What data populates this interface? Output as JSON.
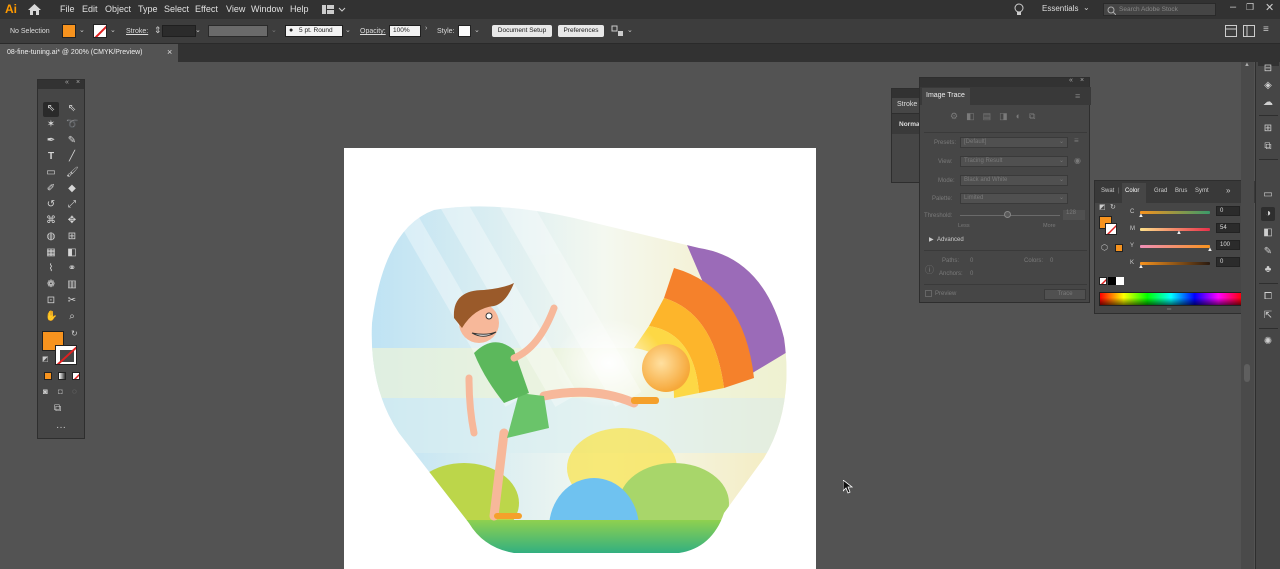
{
  "app": {
    "logo": "Ai"
  },
  "menu": [
    "File",
    "Edit",
    "Object",
    "Type",
    "Select",
    "Effect",
    "View",
    "Window",
    "Help"
  ],
  "workspace": {
    "label": "Essentials",
    "search_placeholder": "Search Adobe Stock"
  },
  "control": {
    "selection": "No Selection",
    "stroke_label": "Stroke:",
    "brush_value": "5 pt. Round",
    "opacity_label": "Opacity:",
    "opacity_value": "100%",
    "style_label": "Style:",
    "document_setup": "Document Setup",
    "preferences": "Preferences"
  },
  "document_tab": {
    "title": "08-fine-tuning.ai* @ 200% (CMYK/Preview)",
    "close": "×"
  },
  "colors": {
    "fill": "#f7931e",
    "accent": "#e8e8e8"
  },
  "stroke_panel": {
    "tab": "Stroke",
    "mode": "Norma"
  },
  "image_trace": {
    "title": "Image Trace",
    "preset_label": "Presets:",
    "preset_value": "[Default]",
    "view_label": "View:",
    "view_value": "Tracing Result",
    "mode_label": "Mode:",
    "mode_value": "Black and White",
    "palette_label": "Palette:",
    "palette_value": "Limited",
    "threshold_label": "Threshold:",
    "threshold_value": "128",
    "less": "Less",
    "more": "More",
    "advanced": "Advanced",
    "paths_label": "Paths:",
    "paths_value": "0",
    "colors_label": "Colors:",
    "colors_value": "0",
    "anchors_label": "Anchors:",
    "anchors_value": "0",
    "preview": "Preview",
    "trace": "Trace"
  },
  "color_panel": {
    "tabs": [
      "Swat",
      "Color",
      "Grad",
      "Brus",
      "Symt"
    ],
    "channels": [
      {
        "label": "C",
        "value": "0",
        "unit": "%"
      },
      {
        "label": "M",
        "value": "54",
        "unit": "%"
      },
      {
        "label": "Y",
        "value": "100",
        "unit": "%"
      },
      {
        "label": "K",
        "value": "0",
        "unit": "%"
      }
    ]
  }
}
